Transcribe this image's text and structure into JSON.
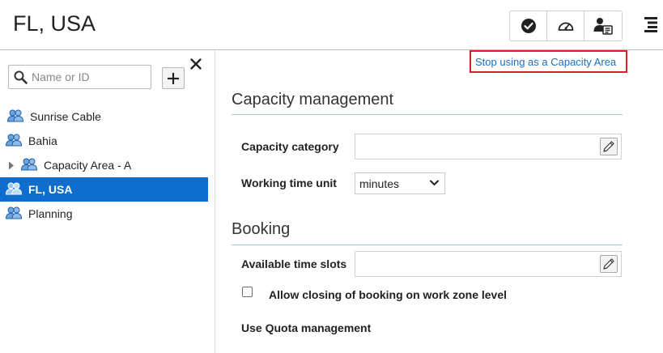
{
  "header": {
    "title": "FL, USA",
    "toolbar": [
      {
        "icon": "check-circle-icon"
      },
      {
        "icon": "speedometer-icon"
      },
      {
        "icon": "user-settings-icon"
      }
    ],
    "menu_icon": "hamburger-menu-icon"
  },
  "sidebar": {
    "search": {
      "placeholder": "Name or ID",
      "value": ""
    },
    "add_icon": "plus-icon",
    "close_icon": "close-icon",
    "items": [
      {
        "label": "Sunrise Cable",
        "icon": "user-group-icon"
      },
      {
        "label": "Bahia",
        "icon": "user-group-icon"
      },
      {
        "label": "Capacity Area - A",
        "icon": "user-group-icon",
        "expandable": true
      },
      {
        "label": "FL, USA",
        "icon": "user-group-icon",
        "selected": true
      },
      {
        "label": "Planning",
        "icon": "user-group-icon"
      }
    ]
  },
  "main": {
    "stop_link": "Stop using as a Capacity Area",
    "capacity_section": {
      "title": "Capacity management",
      "category_label": "Capacity category",
      "category_value": "",
      "time_unit_label": "Working time unit",
      "time_unit_value": "minutes"
    },
    "booking_section": {
      "title": "Booking",
      "slots_label": "Available time slots",
      "slots_value": "",
      "closing_label": "Allow closing of booking on work zone level",
      "closing_checked": false,
      "quota_label": "Use Quota management"
    }
  },
  "colors": {
    "selection": "#0f6ecd",
    "link": "#1a70c4",
    "highlight_border": "#d9202e",
    "section_rule": "#9fcde0"
  }
}
